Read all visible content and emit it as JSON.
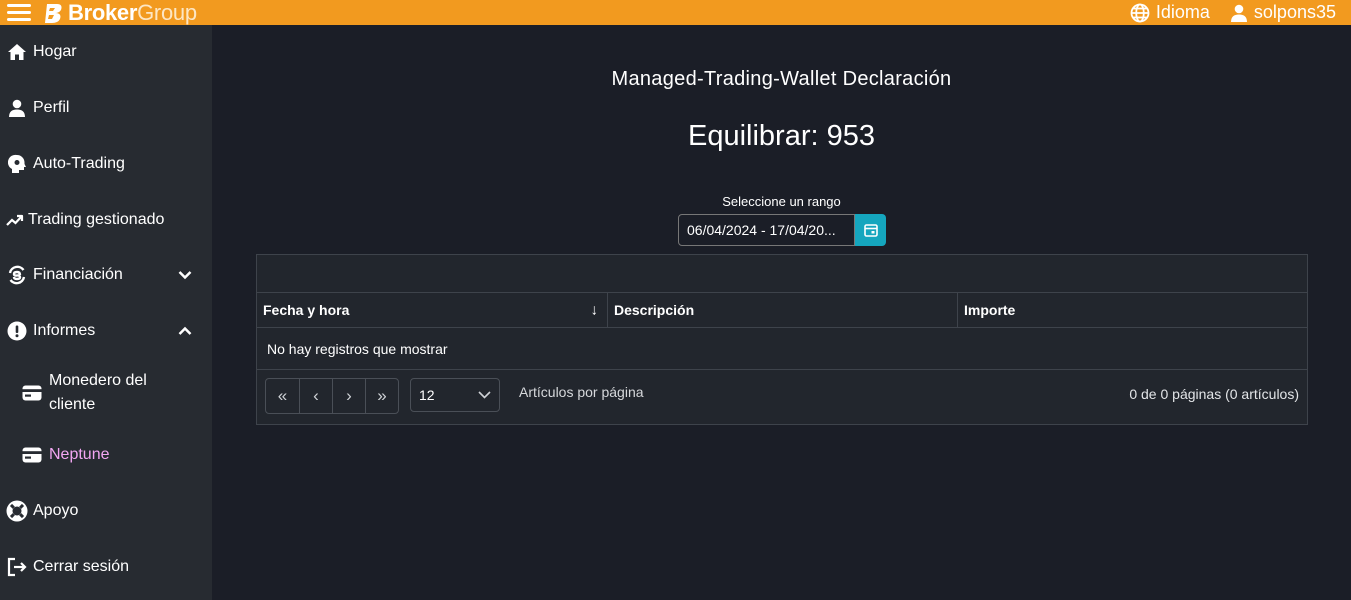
{
  "header": {
    "brand_bold": "Broker",
    "brand_light": "Group",
    "language_label": "Idioma",
    "username": "solpons35"
  },
  "sidebar": {
    "items": [
      {
        "label": "Hogar",
        "icon": "home-icon"
      },
      {
        "label": "Perfil",
        "icon": "user-icon"
      },
      {
        "label": "Auto-Trading",
        "icon": "robot-icon"
      },
      {
        "label": "Trading gestionado",
        "icon": "trending-up-icon"
      },
      {
        "label": "Financiación",
        "icon": "exchange-icon",
        "expanded": false
      },
      {
        "label": "Informes",
        "icon": "alert-icon",
        "expanded": true
      },
      {
        "label": "Apoyo",
        "icon": "lifebuoy-icon"
      },
      {
        "label": "Cerrar sesión",
        "icon": "logout-icon"
      }
    ],
    "sub_items": [
      {
        "label_line1": "Monedero del",
        "label_line2": "cliente",
        "icon": "wallet-icon"
      },
      {
        "label": "Neptune",
        "icon": "wallet-icon",
        "active": true
      }
    ]
  },
  "main": {
    "title": "Managed-Trading-Wallet Declaración",
    "balance_text": "Equilibrar: 953",
    "range_label": "Seleccione un rango",
    "range_value": "06/04/2024 - 17/04/20..."
  },
  "grid": {
    "columns": [
      "Fecha y hora",
      "Descripción",
      "Importe"
    ],
    "sort_indicator": "↓",
    "empty_message": "No hay registros que mostrar",
    "pager": {
      "first": "«",
      "prev": "‹",
      "next": "›",
      "last": "»",
      "page_size": "12",
      "page_size_label": "Artículos por página",
      "info": "0 de 0 páginas (0 artículos)"
    }
  },
  "colors": {
    "topbar": "#f29a1f",
    "sidebar": "#272b31",
    "background": "#1b1e27",
    "active_item": "#f2a6f2",
    "calendar_button": "#15a6be"
  }
}
